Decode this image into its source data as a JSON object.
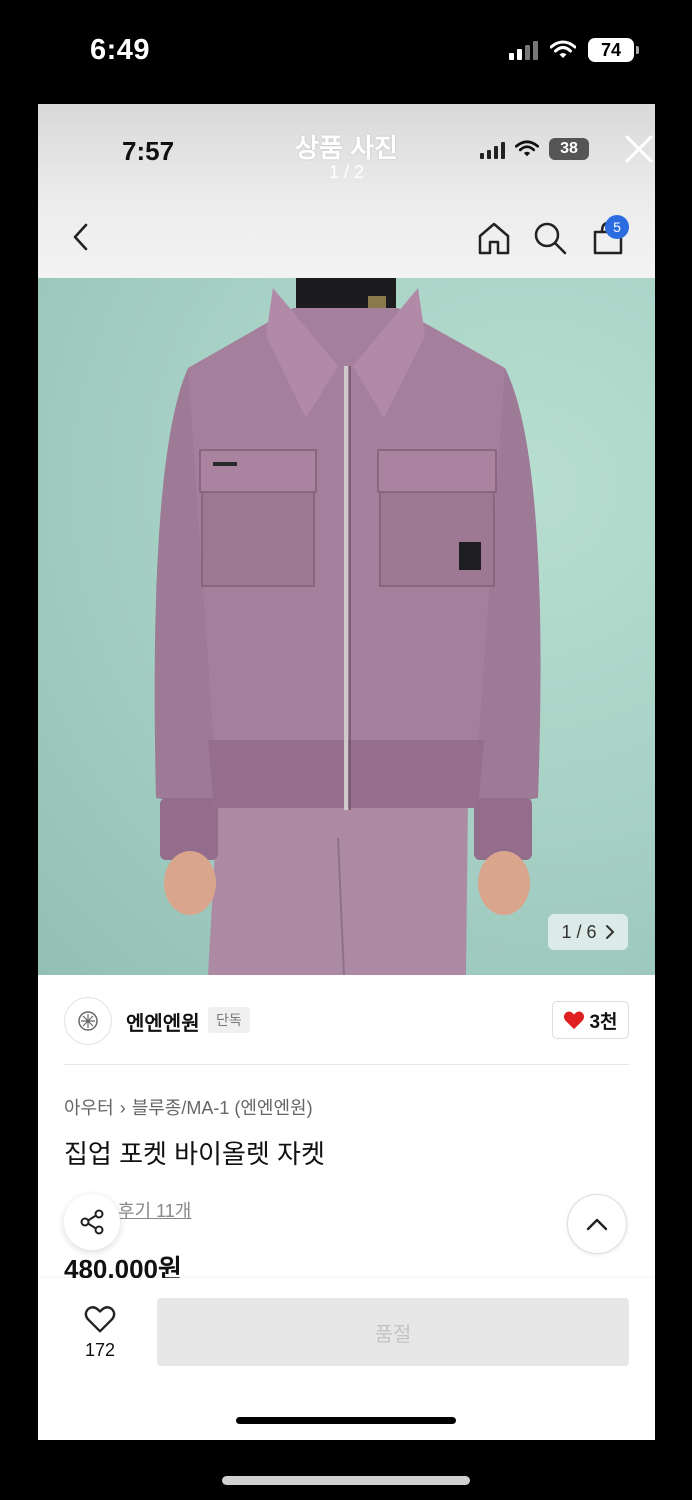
{
  "outer_status": {
    "time": "6:49",
    "battery": "74"
  },
  "viewer": {
    "inner_time": "7:57",
    "title": "상품 사진",
    "counter": "1 / 2",
    "inner_battery": "38"
  },
  "nav": {
    "cart_count": "5"
  },
  "photo": {
    "counter": "1 / 6",
    "accent_color": "#a8d2c6",
    "jacket_color": "#a07a97"
  },
  "brand": {
    "name": "엔엔엔원",
    "tag": "단독",
    "likes": "3천"
  },
  "product": {
    "breadcrumb": [
      "아우터",
      "블루종/MA-1 (엔엔엔원)"
    ],
    "title": "집업 포켓 바이올렛 자켓",
    "review": "후기 11개",
    "price": "480,000원"
  },
  "bottom": {
    "wish_count": "172",
    "cta_label": "품절"
  }
}
